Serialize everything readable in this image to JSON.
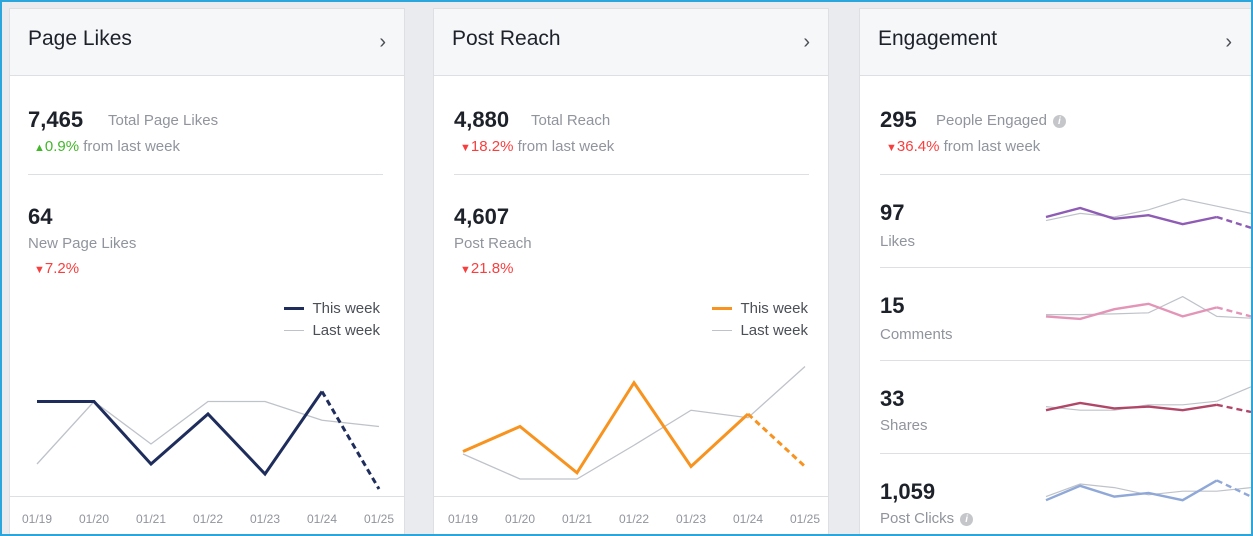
{
  "panels": [
    {
      "title": "Page Likes",
      "total_value": "7,465",
      "total_label": "Total Page Likes",
      "total_change": "0.9%",
      "total_change_suffix": " from last week",
      "sub_value": "64",
      "sub_label": "New Page Likes",
      "sub_change": "7.2%",
      "legend_this": "This week",
      "legend_last": "Last week"
    },
    {
      "title": "Post Reach",
      "total_value": "4,880",
      "total_label": "Total Reach",
      "total_change": "18.2%",
      "total_change_suffix": " from last week",
      "sub_value": "4,607",
      "sub_label": "Post Reach",
      "sub_change": "21.8%",
      "legend_this": "This week",
      "legend_last": "Last week"
    },
    {
      "title": "Engagement",
      "total_value": "295",
      "total_label": "People Engaged",
      "total_change": "36.4%",
      "total_change_suffix": " from last week",
      "rows": [
        {
          "value": "97",
          "label": "Likes"
        },
        {
          "value": "15",
          "label": "Comments"
        },
        {
          "value": "33",
          "label": "Shares"
        },
        {
          "value": "1,059",
          "label": "Post Clicks"
        }
      ]
    }
  ],
  "icons": {
    "chevron": "›",
    "up": "▲",
    "down": "▼",
    "info": "i"
  },
  "colors": {
    "navy": "#1f2d5c",
    "orange": "#f7931e",
    "grey": "#bec2c9",
    "purple": "#8e5bb5",
    "pink": "#e395b8",
    "maroon": "#b04768",
    "blue": "#8fa8d8",
    "up": "#42b72a",
    "down": "#fa3e3e",
    "frame": "#2aa6dc"
  },
  "chart_data": [
    {
      "type": "line",
      "categories": [
        "01/19",
        "01/20",
        "01/21",
        "01/22",
        "01/23",
        "01/24",
        "01/25"
      ],
      "ylim": [
        0,
        100
      ],
      "series": [
        {
          "name": "This week",
          "values": [
            70,
            70,
            20,
            60,
            12,
            78,
            0
          ],
          "projected_from": 5
        },
        {
          "name": "Last week",
          "values": [
            20,
            70,
            36,
            70,
            70,
            55,
            50
          ]
        }
      ]
    },
    {
      "type": "line",
      "categories": [
        "01/19",
        "01/20",
        "01/21",
        "01/22",
        "01/23",
        "01/24",
        "01/25"
      ],
      "ylim": [
        0,
        100
      ],
      "series": [
        {
          "name": "This week",
          "values": [
            30,
            50,
            13,
            85,
            18,
            60,
            18
          ],
          "projected_from": 5
        },
        {
          "name": "Last week",
          "values": [
            28,
            8,
            8,
            35,
            63,
            57,
            98
          ]
        }
      ]
    },
    {
      "type": "line",
      "label": "Likes",
      "ylim": [
        0,
        100
      ],
      "series": [
        {
          "values": [
            50,
            75,
            45,
            55,
            30,
            50,
            20
          ],
          "projected_from": 5
        },
        {
          "values": [
            40,
            60,
            50,
            70,
            100,
            80,
            60
          ]
        }
      ]
    },
    {
      "type": "line",
      "label": "Comments",
      "ylim": [
        0,
        100
      ],
      "series": [
        {
          "values": [
            35,
            28,
            55,
            70,
            35,
            60,
            35
          ],
          "projected_from": 5
        },
        {
          "values": [
            40,
            40,
            42,
            45,
            90,
            35,
            30
          ]
        }
      ]
    },
    {
      "type": "line",
      "label": "Shares",
      "ylim": [
        0,
        100
      ],
      "series": [
        {
          "values": [
            30,
            50,
            35,
            40,
            30,
            45,
            25
          ],
          "projected_from": 5
        },
        {
          "values": [
            40,
            30,
            30,
            45,
            45,
            55,
            95
          ]
        }
      ]
    },
    {
      "type": "line",
      "label": "Post Clicks",
      "ylim": [
        0,
        100
      ],
      "series": [
        {
          "values": [
            30,
            70,
            40,
            50,
            30,
            85,
            40
          ],
          "projected_from": 5
        },
        {
          "values": [
            40,
            75,
            65,
            45,
            55,
            55,
            65
          ]
        }
      ]
    }
  ]
}
